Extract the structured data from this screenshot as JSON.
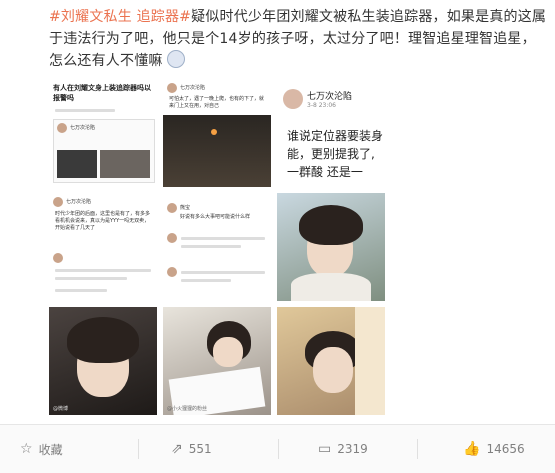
{
  "post": {
    "tag1": "#刘耀文私生 追踪器#",
    "body": "疑似时代少年团刘耀文被私生装追踪器，如果是真的这属于违法行为了吧，他只是个14岁的孩子呀，太过分了吧！理智追星理智追星，怎么还有人不懂嘛",
    "emoji_name": "crying-face-icon"
  },
  "images": [
    {
      "title": "有人在刘耀文身上装追踪器吗以报警吗",
      "user": "七万次沦陷"
    },
    {
      "user": "七万次沦陷",
      "text": "可怕太了，遇了一晚上爬，也有的下了，就来门上又在用，对自己"
    },
    {
      "user": "七万次沦陷",
      "time": "3-8 23:06",
      "line1": "谁说定位器要装身",
      "line2": "能，更别提我了,",
      "line3": "一群酸 还是一"
    },
    {
      "user": "七万次沦陷",
      "text": "时代少年团的后面，这里也是有了，有多多看机机会说来，真以为是YYY一吗无双卖，开始说看了几天了"
    },
    {
      "user": "熊宝",
      "text": "好说有多么大事吧可能说什么样"
    },
    {
      "caption": ""
    },
    {
      "caption": "@微博"
    },
    {
      "caption": "@小火狸狸的粉丝"
    },
    {
      "caption": ""
    }
  ],
  "actions": {
    "favorite_label": "收藏",
    "repost_count": "551",
    "comment_count": "2319",
    "like_count": "14656"
  },
  "colors": {
    "tag": "#eb7350",
    "text": "#333333",
    "action": "#808080"
  }
}
